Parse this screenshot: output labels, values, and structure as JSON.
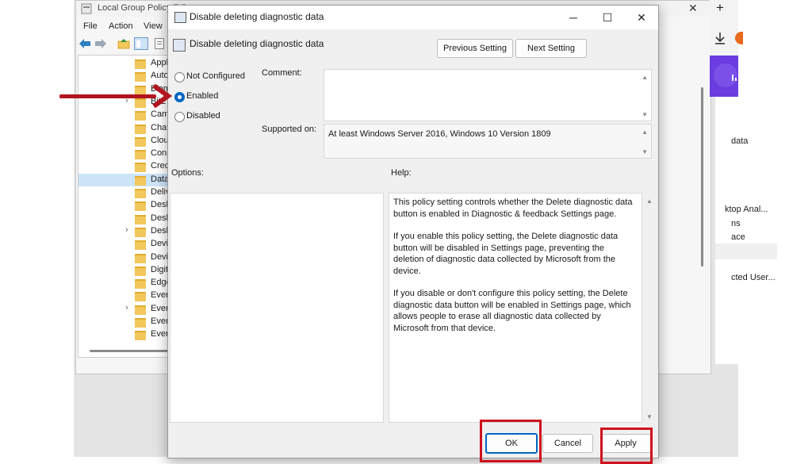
{
  "background_window": {
    "title": "Local Group Policy Edi",
    "menu": [
      "File",
      "Action",
      "View"
    ],
    "tree_items": [
      {
        "label": "Appli",
        "expandable": false,
        "selected": false
      },
      {
        "label": "Auto",
        "expandable": false,
        "selected": false
      },
      {
        "label": "Biom",
        "expandable": false,
        "selected": false
      },
      {
        "label": "BitL",
        "expandable": true,
        "selected": false
      },
      {
        "label": "Cam",
        "expandable": false,
        "selected": false
      },
      {
        "label": "Chat",
        "expandable": false,
        "selected": false
      },
      {
        "label": "Clou",
        "expandable": false,
        "selected": false
      },
      {
        "label": "Conr",
        "expandable": false,
        "selected": false
      },
      {
        "label": "Cred",
        "expandable": false,
        "selected": false
      },
      {
        "label": "Data",
        "expandable": false,
        "selected": true
      },
      {
        "label": "Deliv",
        "expandable": false,
        "selected": false
      },
      {
        "label": "Desk",
        "expandable": false,
        "selected": false
      },
      {
        "label": "Desk",
        "expandable": false,
        "selected": false
      },
      {
        "label": "Desk",
        "expandable": true,
        "selected": false
      },
      {
        "label": "Devi",
        "expandable": false,
        "selected": false
      },
      {
        "label": "Devi",
        "expandable": false,
        "selected": false
      },
      {
        "label": "Digit",
        "expandable": false,
        "selected": false
      },
      {
        "label": "Edge",
        "expandable": false,
        "selected": false
      },
      {
        "label": "Even",
        "expandable": false,
        "selected": false
      },
      {
        "label": "Even",
        "expandable": true,
        "selected": false
      },
      {
        "label": "Even",
        "expandable": false,
        "selected": false
      },
      {
        "label": "Even",
        "expandable": false,
        "selected": false
      }
    ],
    "right_items": [
      "data",
      "ktop Anal...",
      "ns",
      "ace",
      "cted User..."
    ]
  },
  "dialog": {
    "title": "Disable deleting diagnostic data",
    "policy_name": "Disable deleting diagnostic data",
    "prev_button": "Previous Setting",
    "next_button": "Next Setting",
    "options": {
      "not_configured": "Not Configured",
      "enabled": "Enabled",
      "disabled": "Disabled",
      "selected": "enabled"
    },
    "comment_label": "Comment:",
    "comment_value": "",
    "supported_label": "Supported on:",
    "supported_value": "At least Windows Server 2016, Windows 10 Version 1809",
    "options_label": "Options:",
    "help_label": "Help:",
    "help_paragraphs": [
      "This policy setting controls whether the Delete diagnostic data button is enabled in Diagnostic & feedback Settings page.",
      "If you enable this policy setting, the Delete diagnostic data button will be disabled in Settings page, preventing the deletion of diagnostic data collected by Microsoft from the device.",
      "If you disable or don't configure this policy setting, the Delete diagnostic data button will be enabled in Settings page, which allows people to erase all diagnostic data collected by Microsoft from that device."
    ],
    "ok_button": "OK",
    "cancel_button": "Cancel",
    "apply_button": "Apply"
  },
  "colors": {
    "annotation_red": "#d0101d",
    "arrow_red": "#b2151f",
    "accent": "#0067c0"
  }
}
